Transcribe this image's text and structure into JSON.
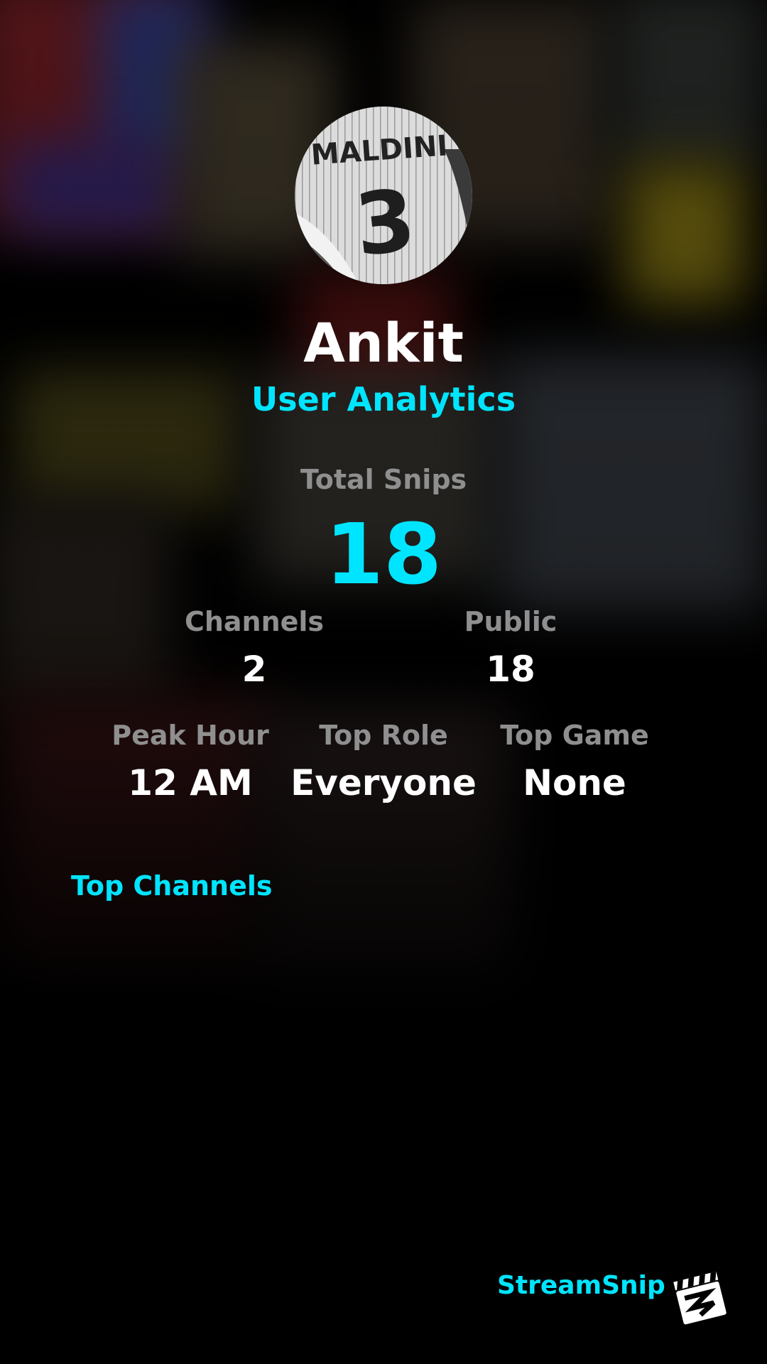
{
  "profile": {
    "avatar_icon": "jersey-avatar",
    "name": "Ankit",
    "subtitle": "User Analytics"
  },
  "stats": {
    "total_snips": {
      "label": "Total Snips",
      "value": "18"
    },
    "channels": {
      "label": "Channels",
      "value": "2"
    },
    "public": {
      "label": "Public",
      "value": "18"
    },
    "peak_hour": {
      "label": "Peak Hour",
      "value": "12 AM"
    },
    "top_role": {
      "label": "Top Role",
      "value": "Everyone"
    },
    "top_game": {
      "label": "Top Game",
      "value": "None"
    }
  },
  "sections": {
    "top_channels": "Top Channels"
  },
  "branding": {
    "name": "StreamSnip",
    "logo_icon": "clapperboard-logo-icon"
  },
  "colors": {
    "accent": "#00e5ff",
    "label_gray": "#8f8f8f",
    "background": "#000000"
  }
}
